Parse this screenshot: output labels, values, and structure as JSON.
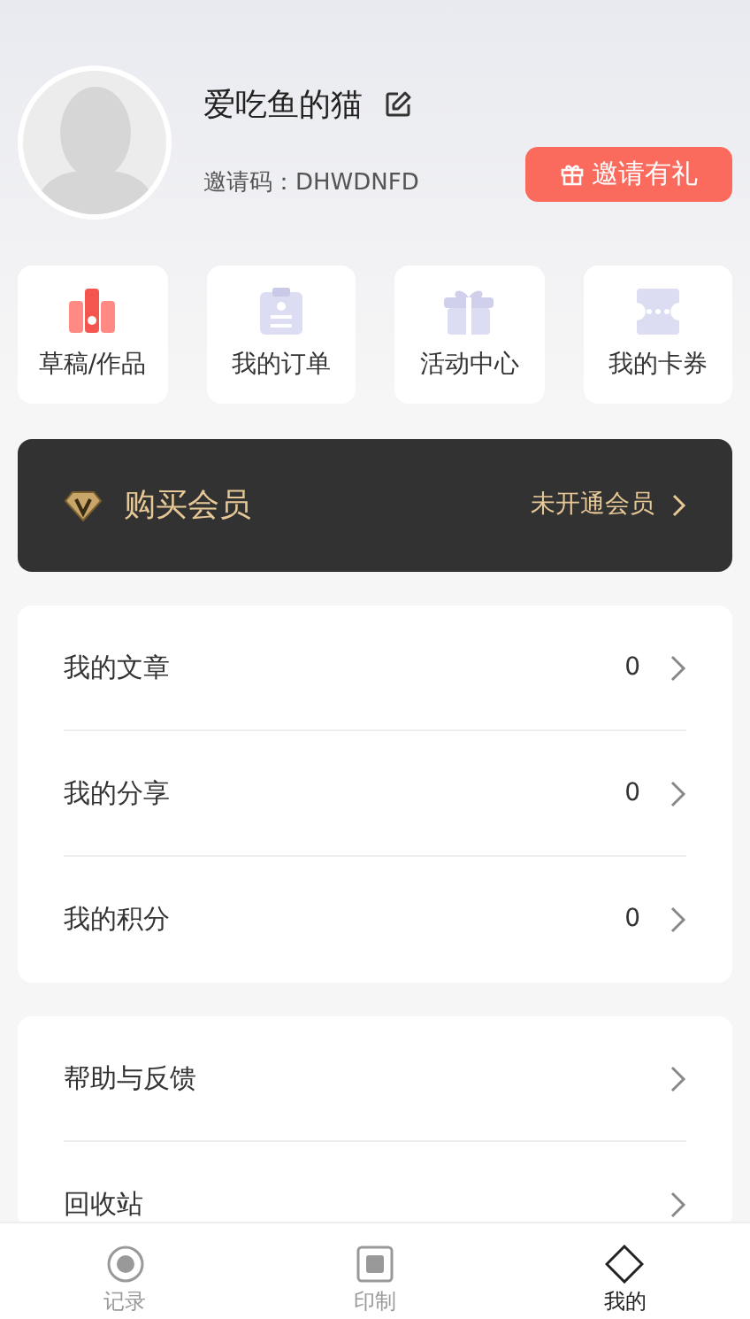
{
  "profile": {
    "name": "爱吃鱼的猫",
    "invite_code": "邀请码：DHWDNFD",
    "invite_button": "邀请有礼"
  },
  "shortcuts": [
    {
      "label": "草稿/作品",
      "kind": "drafts"
    },
    {
      "label": "我的订单",
      "kind": "orders"
    },
    {
      "label": "活动中心",
      "kind": "events"
    },
    {
      "label": "我的卡券",
      "kind": "coupons"
    }
  ],
  "membership": {
    "title": "购买会员",
    "status": "未开通会员"
  },
  "stats": [
    {
      "label": "我的文章",
      "count": "0"
    },
    {
      "label": "我的分享",
      "count": "0"
    },
    {
      "label": "我的积分",
      "count": "0"
    }
  ],
  "links": [
    {
      "label": "帮助与反馈"
    },
    {
      "label": "回收站"
    }
  ],
  "tab_bar": [
    {
      "label": "记录",
      "kind": "record",
      "selected": false
    },
    {
      "label": "印制",
      "kind": "print",
      "selected": false
    },
    {
      "label": "我的",
      "kind": "mine",
      "selected": true
    }
  ]
}
